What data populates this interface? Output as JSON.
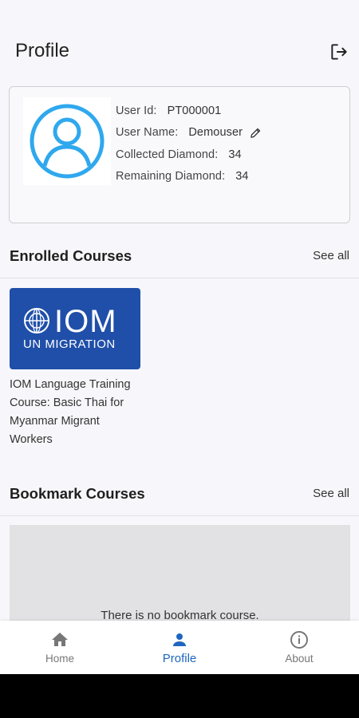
{
  "header": {
    "title": "Profile"
  },
  "profile": {
    "user_id_label": "User Id:",
    "user_id": "PT000001",
    "user_name_label": "User Name:",
    "user_name": "Demouser",
    "collected_label": "Collected Diamond:",
    "collected": "34",
    "remaining_label": "Remaining Diamond:",
    "remaining": "34"
  },
  "enrolled": {
    "title": "Enrolled Courses",
    "see_all": "See all",
    "courses": [
      {
        "logo_main": "IOM",
        "logo_sub": "UN MIGRATION",
        "title": "IOM Language Training Course: Basic Thai for Myanmar Migrant Workers"
      }
    ]
  },
  "bookmark": {
    "title": "Bookmark Courses",
    "see_all": "See all",
    "empty_message": "There is no bookmark course."
  },
  "nav": {
    "items": [
      {
        "label": "Home",
        "icon": "home-icon",
        "active": false
      },
      {
        "label": "Profile",
        "icon": "person-icon",
        "active": true
      },
      {
        "label": "About",
        "icon": "info-icon",
        "active": false
      }
    ]
  },
  "colors": {
    "accent": "#1e66c0",
    "avatar": "#2fa8ee",
    "iom_blue": "#1f4fa9"
  }
}
